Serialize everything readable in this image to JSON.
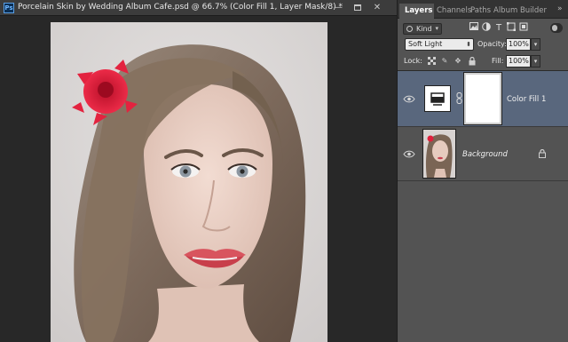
{
  "document": {
    "app_icon": "Ps",
    "title": "Porcelain Skin by Wedding Album Cafe.psd @ 66.7% (Color Fill 1, Layer Mask/8) *",
    "window_buttons": {
      "minimize": "—",
      "close": "✕"
    }
  },
  "canvas": {
    "image": "portrait photo of a woman with a red flower in her hair"
  },
  "panel": {
    "tabs": [
      {
        "label": "Layers",
        "active": true
      },
      {
        "label": "Channels",
        "active": false
      },
      {
        "label": "Paths",
        "active": false
      },
      {
        "label": "Album Builder",
        "active": false
      }
    ],
    "menu_icon": "»",
    "filter": {
      "kind_label": "Kind",
      "icons": [
        "image-filter-icon",
        "adjustment-filter-icon",
        "type-filter-icon",
        "shape-filter-icon",
        "smart-object-filter-icon"
      ]
    },
    "blend_mode": "Soft Light",
    "opacity_label": "Opacity:",
    "opacity_value": "100%",
    "lock_label": "Lock:",
    "fill_label": "Fill:",
    "fill_value": "100%"
  },
  "layers": [
    {
      "name": "Color Fill 1",
      "selected": true,
      "visible": true
    },
    {
      "name": "Background",
      "selected": false,
      "visible": true,
      "locked": true
    }
  ],
  "colors": {
    "panel_bg": "#535353",
    "selected_layer": "#59677d",
    "flower_red": "#e0203c"
  }
}
